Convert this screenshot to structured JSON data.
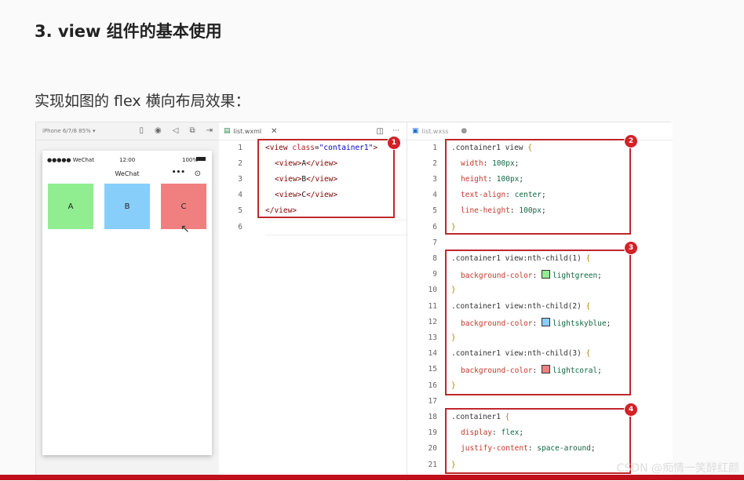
{
  "heading": "3. view 组件的基本使用",
  "subheading": "实现如图的 flex 横向布局效果：",
  "simulator": {
    "device": "iPhone 6/7/8 85% ▾",
    "carrier": "●●●●● WeChat",
    "time": "12:00",
    "battery": "100%",
    "nav_title": "WeChat",
    "boxes": [
      {
        "label": "A",
        "color": "#90ee90"
      },
      {
        "label": "B",
        "color": "#87cefa"
      },
      {
        "label": "C",
        "color": "#f08080"
      }
    ]
  },
  "wxml": {
    "tab_label": "list.wxml",
    "lines": [
      "1",
      "2",
      "3",
      "4",
      "5",
      "6"
    ]
  },
  "wxss": {
    "tab_label": "list.wxss",
    "lines": [
      "1",
      "2",
      "3",
      "4",
      "5",
      "6",
      "7",
      "8",
      "9",
      "10",
      "11",
      "12",
      "13",
      "14",
      "15",
      "16",
      "17",
      "18",
      "19",
      "20",
      "21"
    ]
  },
  "badges": [
    "1",
    "2",
    "3",
    "4"
  ],
  "watermark": "CSDN @痴情一笑醉红颜",
  "accent_color": "#c0272d"
}
